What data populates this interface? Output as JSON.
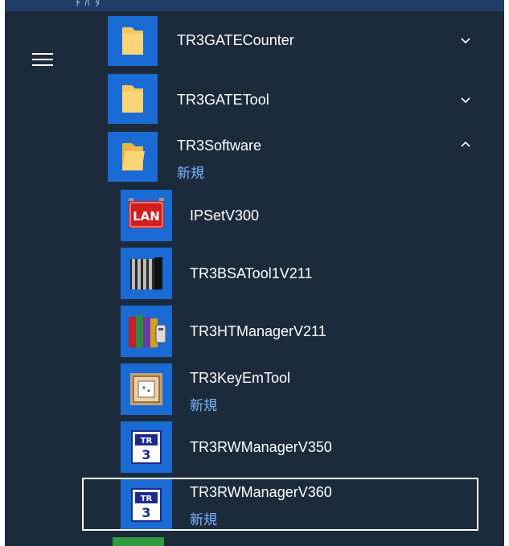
{
  "top": {
    "partial_text": "ﾄ ﾊﾞﾀﾞ"
  },
  "groups": [
    {
      "name": "TR3GATECounter",
      "expanded": false
    },
    {
      "name": "TR3GATETool",
      "expanded": false
    },
    {
      "name": "TR3Software",
      "expanded": true,
      "badge": "新規"
    }
  ],
  "apps": [
    {
      "name": "IPSetV300",
      "badge": "",
      "icon": "lan-icon"
    },
    {
      "name": "TR3BSATool1V211",
      "badge": "",
      "icon": "server-rack-icon"
    },
    {
      "name": "TR3HTManagerV211",
      "badge": "",
      "icon": "books-icon"
    },
    {
      "name": "TR3KeyEmTool",
      "badge": "新規",
      "icon": "key-emulator-icon"
    },
    {
      "name": "TR3RWManagerV350",
      "badge": "",
      "icon": "tr3-rw-icon"
    },
    {
      "name": "TR3RWManagerV360",
      "badge": "新規",
      "icon": "tr3-rw-icon",
      "selected": true
    }
  ],
  "colors": {
    "menu_bg": "#1c2b3c",
    "tile_blue": "#1a6bd3",
    "new_badge": "#7ab5ff",
    "folder": "#f5c95e"
  }
}
